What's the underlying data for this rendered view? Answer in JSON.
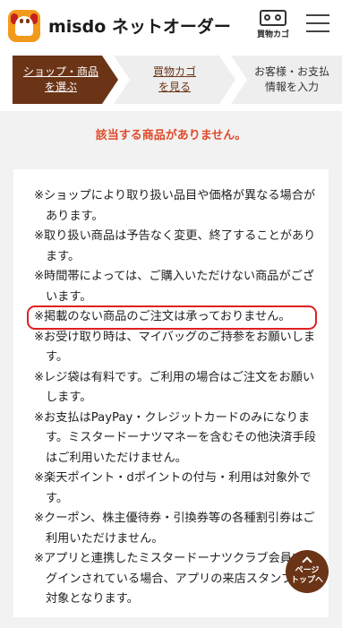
{
  "header": {
    "brand": "misdo ネットオーダー",
    "cart_label": "買物カゴ"
  },
  "steps": [
    {
      "line1": "ショップ・商品",
      "line2": "を選ぶ",
      "state": "active"
    },
    {
      "line1": "買物カゴ",
      "line2": "を見る",
      "state": "link"
    },
    {
      "line1": "お客様・お支払",
      "line2": "情報を入力",
      "state": "upcoming"
    }
  ],
  "notice": "該当する商品がありません。",
  "notes": [
    "※ショップにより取り扱い品目や価格が異なる場合があります。",
    "※取り扱い商品は予告なく変更、終了することがあります。",
    "※時間帯によっては、ご購入いただけない商品がございます。",
    "※掲載のない商品のご注文は承っておりません。",
    "※お受け取り時は、マイバッグのご持参をお願いします。",
    "※レジ袋は有料です。ご利用の場合はご注文をお願いします。",
    "※お支払はPayPay・クレジットカードのみになります。ミスタードーナツマネーを含むその他決済手段はご利用いただけません。",
    "※楽天ポイント・dポイントの付与・利用は対象外です。",
    "※クーポン、株主優待券・引換券等の各種割引券はご利用いただけません。",
    "※アプリと連携したミスタードーナツクラブ会員でログインされている場合、アプリの来店スタンプ付与対象となります。"
  ],
  "page_top": {
    "line1": "ページ",
    "line2": "トップへ"
  },
  "colors": {
    "brand_brown": "#6b3416",
    "notice_red": "#e04a2a",
    "logo_orange": "#f29a1d",
    "highlight_red": "#e02020"
  },
  "icons": {
    "logo": "misdo-logo-icon",
    "cart": "shopping-cart-icon",
    "menu": "hamburger-menu-icon",
    "page_top": "arrow-up-icon"
  }
}
